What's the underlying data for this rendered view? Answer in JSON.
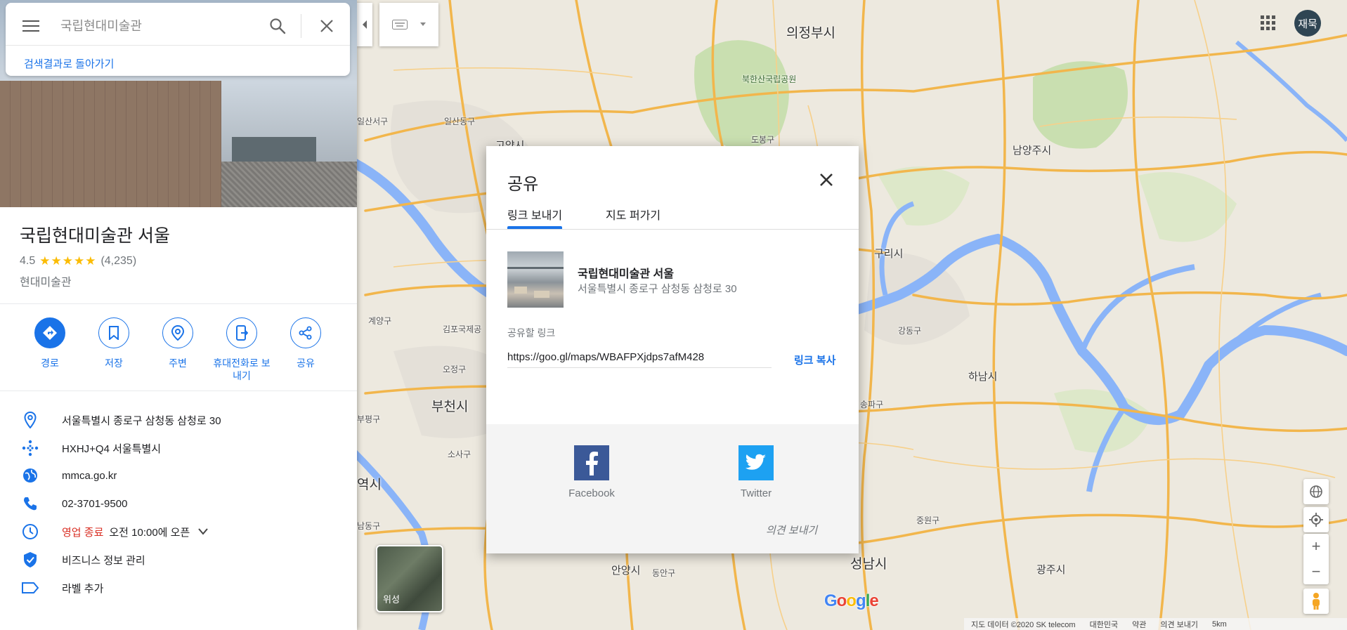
{
  "search": {
    "placeholder": "국립현대미술관",
    "back_label": "검색결과로 돌아가기"
  },
  "place": {
    "name": "국립현대미술관 서울",
    "rating": "4.5",
    "stars": "★★★★★",
    "review_count": "(4,235)",
    "category": "현대미술관"
  },
  "actions": [
    {
      "label": "경로",
      "icon": "directions-icon"
    },
    {
      "label": "저장",
      "icon": "bookmark-icon"
    },
    {
      "label": "주변",
      "icon": "nearby-icon"
    },
    {
      "label": "휴대전화로 보내기",
      "icon": "send-to-phone-icon"
    },
    {
      "label": "공유",
      "icon": "share-icon"
    }
  ],
  "info": {
    "address": "서울특별시 종로구 삼청동 삼청로 30",
    "plus_code": "HXHJ+Q4 서울특별시",
    "website": "mmca.go.kr",
    "phone": "02-3701-9500",
    "hours_status": "영업 종료",
    "hours_detail": "오전 10:00에 오픈",
    "business_info": "비즈니스 정보 관리",
    "add_label": "라벨 추가"
  },
  "dialog": {
    "title": "공유",
    "tabs": [
      "링크 보내기",
      "지도 퍼가기"
    ],
    "place_name": "국립현대미술관 서울",
    "place_address": "서울특별시 종로구 삼청동 삼청로 30",
    "share_label": "공유할 링크",
    "share_url": "https://goo.gl/maps/WBAFPXjdps7afM428",
    "copy_label": "링크 복사",
    "social": [
      {
        "name": "Facebook",
        "color": "#3b5998"
      },
      {
        "name": "Twitter",
        "color": "#1da1f2"
      }
    ],
    "feedback": "의견 보내기"
  },
  "map": {
    "labels": {
      "uijeongbu": "의정부시",
      "bukhansan": "북한산국립공원",
      "ilsanseo": "일산서구",
      "ilsandong": "일산동구",
      "goyang": "고양시",
      "dobong": "도봉구",
      "namyangju": "남양주시",
      "guri": "구리시",
      "gyeyang": "계양구",
      "gimpo_airport": "김포국제공",
      "gangdong": "강동구",
      "hanam": "하남시",
      "ojeong": "오정구",
      "bucheon": "부천시",
      "bupyeong": "부평구",
      "songpa": "송파구",
      "sosa": "소사구",
      "incheon_partial": "역시",
      "namdong": "남동구",
      "jungwon": "중원구",
      "anyang": "안양시",
      "dongan": "동안구",
      "seongnam": "성남시",
      "gwangju": "광주시"
    },
    "avatar": "재묵",
    "satellite_label": "위성",
    "google_logo": "Google",
    "footer": {
      "map_data": "지도 데이터 ©2020 SK telecom",
      "country": "대한민국",
      "terms": "약관",
      "feedback": "의견 보내기",
      "scale": "5km"
    },
    "colors": {
      "land": "#ede9df",
      "water": "#8ab4f8",
      "road": "#f2b64c",
      "park": "#c3dba4"
    }
  }
}
